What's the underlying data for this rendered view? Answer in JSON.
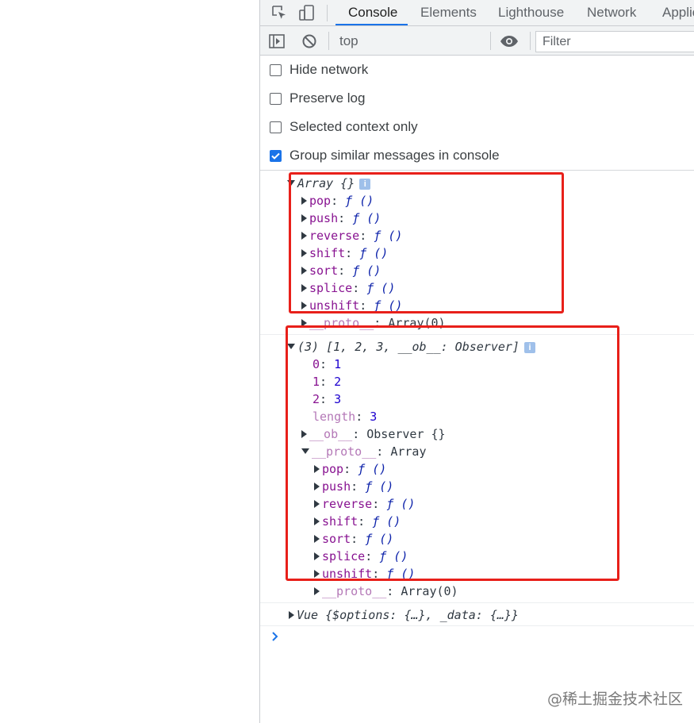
{
  "tabs": [
    {
      "label": "Console",
      "active": true
    },
    {
      "label": "Elements"
    },
    {
      "label": "Lighthouse"
    },
    {
      "label": "Network"
    },
    {
      "label": "Applic"
    }
  ],
  "toolbar": {
    "context": "top",
    "filter_placeholder": "Filter"
  },
  "settings": [
    {
      "label": "Hide network",
      "checked": false
    },
    {
      "label": "Preserve log",
      "checked": false
    },
    {
      "label": "Selected context only",
      "checked": false
    },
    {
      "label": "Group similar messages in console",
      "checked": true
    }
  ],
  "log1": {
    "header": "Array {}",
    "items": [
      {
        "key": "pop",
        "value": "ƒ ()"
      },
      {
        "key": "push",
        "value": "ƒ ()"
      },
      {
        "key": "reverse",
        "value": "ƒ ()"
      },
      {
        "key": "shift",
        "value": "ƒ ()"
      },
      {
        "key": "sort",
        "value": "ƒ ()"
      },
      {
        "key": "splice",
        "value": "ƒ ()"
      },
      {
        "key": "unshift",
        "value": "ƒ ()"
      }
    ],
    "proto_key": "__proto__",
    "proto_value": "Array(0)"
  },
  "log2": {
    "header_prefix": "(3) [",
    "header_values": "1, 2, 3, ",
    "header_ob_key": "__ob__",
    "header_ob_value": ": Observer]",
    "entries": [
      {
        "key": "0",
        "value": "1"
      },
      {
        "key": "1",
        "value": "2"
      },
      {
        "key": "2",
        "value": "3"
      },
      {
        "key": "length",
        "value": "3"
      }
    ],
    "ob_key": "__ob__",
    "ob_value": "Observer {}",
    "proto_key": "__proto__",
    "proto_value": "Array",
    "proto_items": [
      {
        "key": "pop",
        "value": "ƒ ()"
      },
      {
        "key": "push",
        "value": "ƒ ()"
      },
      {
        "key": "reverse",
        "value": "ƒ ()"
      },
      {
        "key": "shift",
        "value": "ƒ ()"
      },
      {
        "key": "sort",
        "value": "ƒ ()"
      },
      {
        "key": "splice",
        "value": "ƒ ()"
      },
      {
        "key": "unshift",
        "value": "ƒ ()"
      }
    ],
    "inner_proto_key": "__proto__",
    "inner_proto_value": "Array(0)"
  },
  "log3": {
    "text": "Vue {$options: {…}, _data: {…}}"
  },
  "watermark": "@稀土掘金技术社区",
  "colors": {
    "accent": "#1a73e8",
    "highlight_box": "#e8201a",
    "property_key": "#881391",
    "number": "#1c00cf"
  }
}
